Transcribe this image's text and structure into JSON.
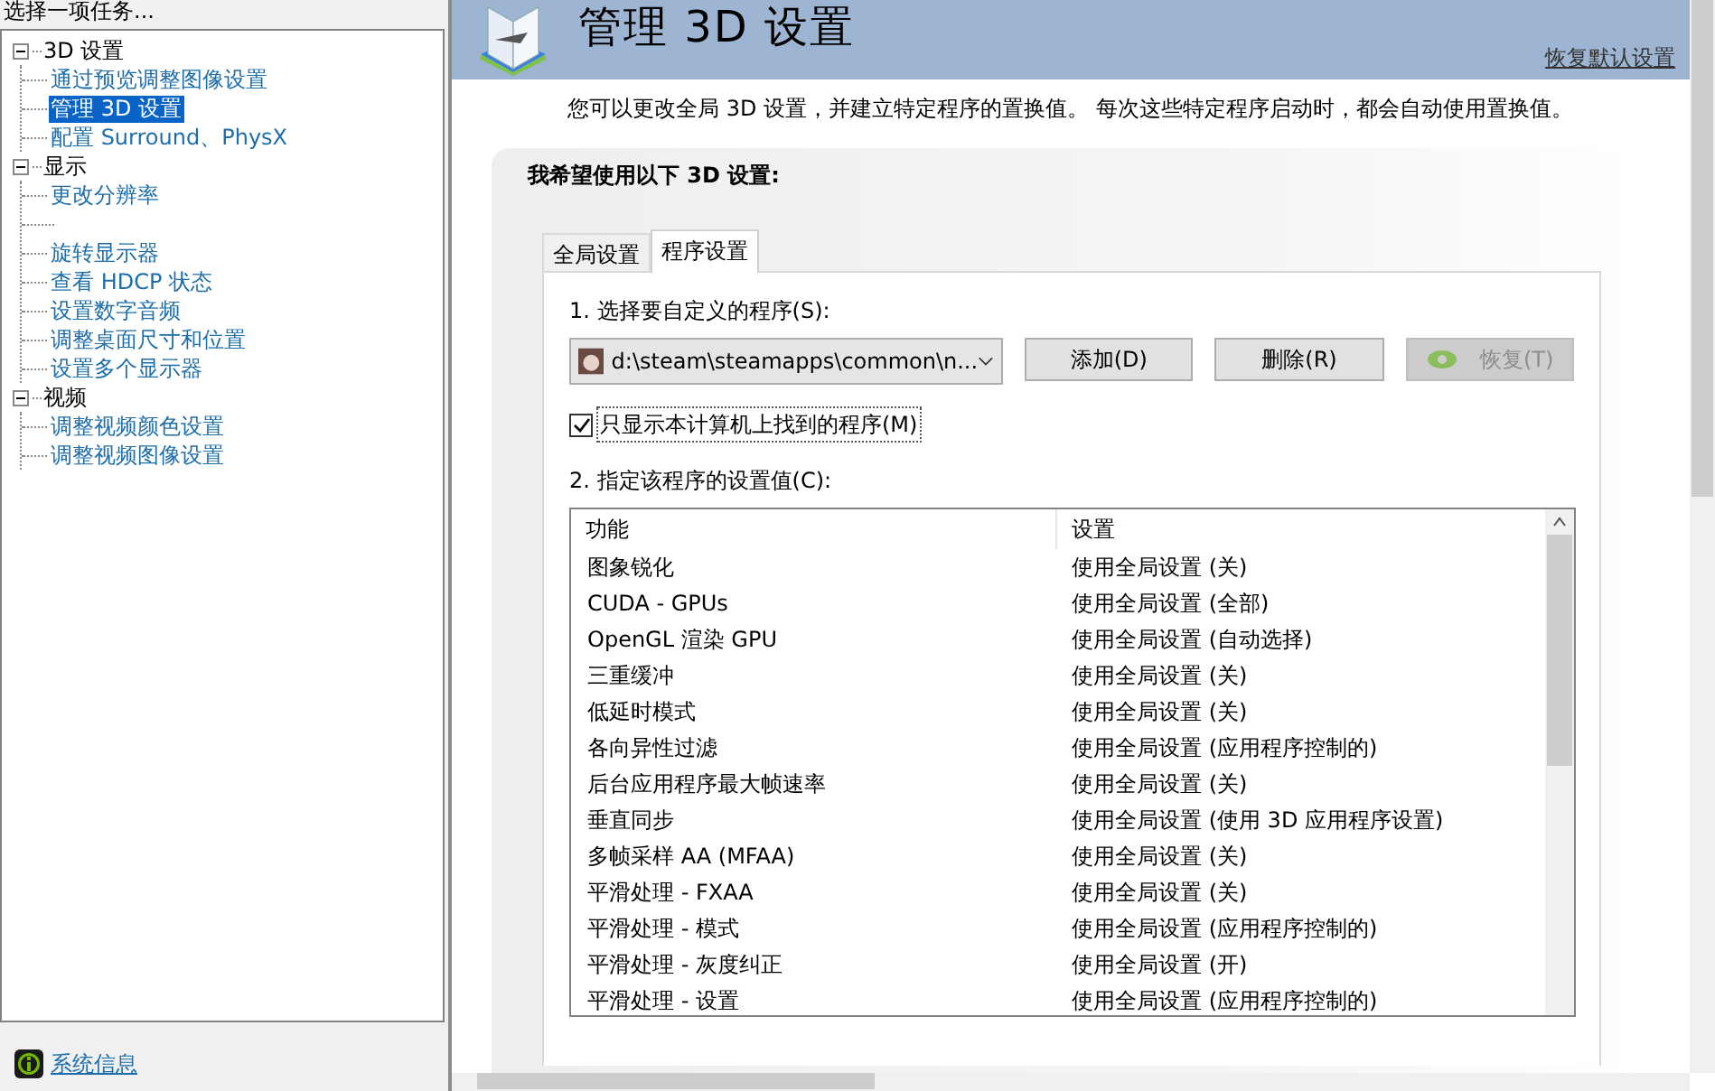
{
  "sidebar": {
    "title": "选择一项任务...",
    "tree": [
      {
        "label": "3D 设置",
        "expanded": true,
        "children": [
          {
            "label": "通过预览调整图像设置",
            "selected": false
          },
          {
            "label": "管理 3D 设置",
            "selected": true
          },
          {
            "label": "配置 Surround、PhysX",
            "selected": false
          }
        ]
      },
      {
        "label": "显示",
        "expanded": true,
        "children": [
          {
            "label": "更改分辨率",
            "selected": false
          },
          {
            "kind": "stub"
          },
          {
            "label": "旋转显示器",
            "selected": false
          },
          {
            "label": "查看 HDCP 状态",
            "selected": false
          },
          {
            "label": "设置数字音频",
            "selected": false
          },
          {
            "label": "调整桌面尺寸和位置",
            "selected": false
          },
          {
            "label": "设置多个显示器",
            "selected": false
          }
        ]
      },
      {
        "label": "视频",
        "expanded": true,
        "children": [
          {
            "label": "调整视频颜色设置",
            "selected": false
          },
          {
            "label": "调整视频图像设置",
            "selected": false
          }
        ]
      }
    ],
    "footer_link": "系统信息"
  },
  "header": {
    "title": "管理 3D 设置",
    "restore_defaults": "恢复默认设置"
  },
  "description": "您可以更改全局 3D 设置，并建立特定程序的置换值。 每次这些特定程序启动时，都会自动使用置换值。",
  "panel": {
    "heading": "我希望使用以下 3D 设置:",
    "tabs": [
      {
        "label": "全局设置",
        "selected": false
      },
      {
        "label": "程序设置",
        "selected": true
      }
    ],
    "step1": "1. 选择要自定义的程序(S):",
    "program": "d:\\steam\\steamapps\\common\\n...",
    "buttons": [
      {
        "label": "添加(D)",
        "disabled": false
      },
      {
        "label": "删除(R)",
        "disabled": false
      },
      {
        "label": "恢复(T)",
        "disabled": true
      }
    ],
    "only_local": {
      "label": "只显示本计算机上找到的程序(M)",
      "checked": true
    },
    "step2": "2. 指定该程序的设置值(C):",
    "table": {
      "columns": [
        "功能",
        "设置"
      ],
      "rows": [
        [
          "图象锐化",
          "使用全局设置 (关)"
        ],
        [
          "CUDA - GPUs",
          "使用全局设置 (全部)"
        ],
        [
          "OpenGL 渲染 GPU",
          "使用全局设置 (自动选择)"
        ],
        [
          "三重缓冲",
          "使用全局设置 (关)"
        ],
        [
          "低延时模式",
          "使用全局设置 (关)"
        ],
        [
          "各向异性过滤",
          "使用全局设置 (应用程序控制的)"
        ],
        [
          "后台应用程序最大帧速率",
          "使用全局设置 (关)"
        ],
        [
          "垂直同步",
          "使用全局设置 (使用 3D 应用程序设置)"
        ],
        [
          "多帧采样 AA (MFAA)",
          "使用全局设置 (关)"
        ],
        [
          "平滑处理 - FXAA",
          "使用全局设置 (关)"
        ],
        [
          "平滑处理 - 模式",
          "使用全局设置 (应用程序控制的)"
        ],
        [
          "平滑处理 - 灰度纠正",
          "使用全局设置 (开)"
        ],
        [
          "平滑处理 - 设置",
          "使用全局设置 (应用程序控制的)"
        ]
      ]
    }
  }
}
